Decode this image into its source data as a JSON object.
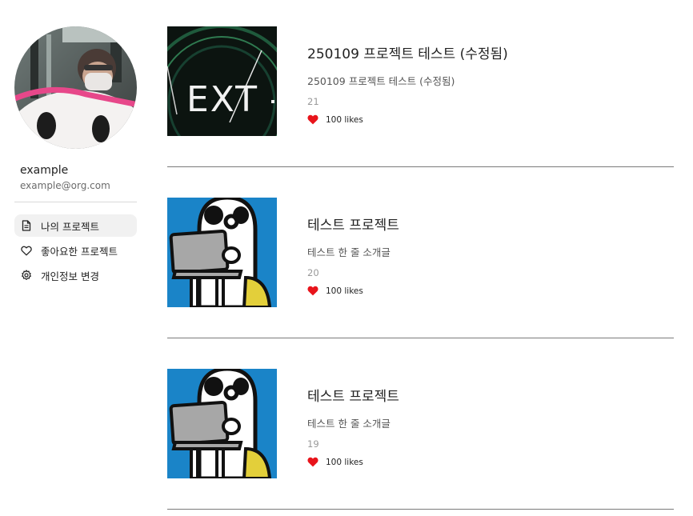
{
  "profile": {
    "name": "example",
    "email": "example@org.com"
  },
  "menu": {
    "items": [
      {
        "label": "나의 프로젝트",
        "icon": "document-icon",
        "active": true
      },
      {
        "label": "좋아요한 프로젝트",
        "icon": "heart-outline-icon",
        "active": false
      },
      {
        "label": "개인정보 변경",
        "icon": "gear-icon",
        "active": false
      }
    ]
  },
  "projects": [
    {
      "title": "250109 프로젝트 테스트 (수정됨)",
      "subtitle": "250109 프로젝트 테스트 (수정됨)",
      "count": "21",
      "likes": "100 likes",
      "thumbnail": "next-logo-thumbnail"
    },
    {
      "title": "테스트 프로젝트",
      "subtitle": "테스트 한 줄 소개글",
      "count": "20",
      "likes": "100 likes",
      "thumbnail": "cartoon-laptop-thumbnail"
    },
    {
      "title": "테스트 프로젝트",
      "subtitle": "테스트 한 줄 소개글",
      "count": "19",
      "likes": "100 likes",
      "thumbnail": "cartoon-laptop-thumbnail"
    }
  ],
  "thumbnail_texts": {
    "next_logo": "EXT"
  },
  "colors": {
    "heart": "#e8141b",
    "active_menu_bg": "#f1f1f1",
    "divider": "#7a7a7a"
  }
}
